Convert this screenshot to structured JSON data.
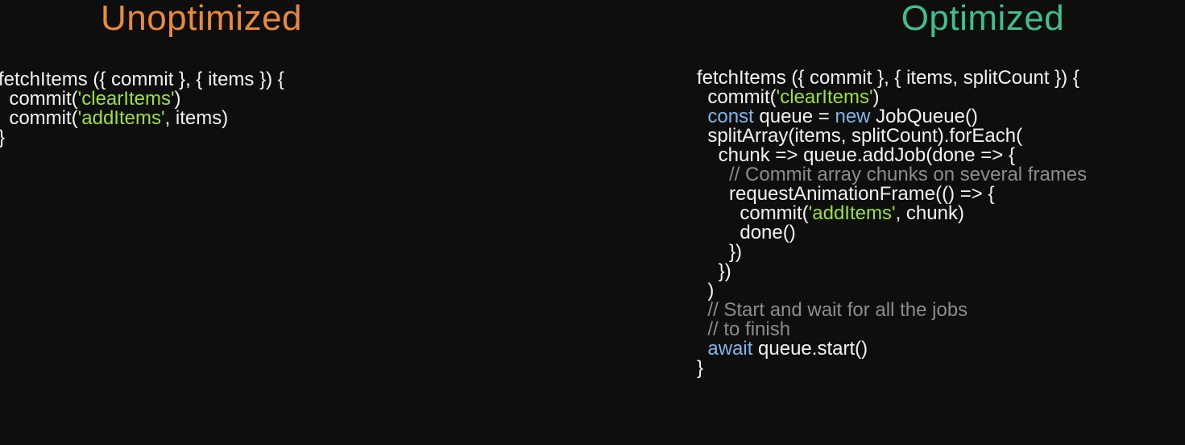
{
  "colors": {
    "unoptimized": "#e8893c",
    "optimized": "#3fbf8f",
    "string": "#9be03c",
    "keyword": "#7fb6ea",
    "comment": "#8c8c8c",
    "plain": "#f2f2f2"
  },
  "left": {
    "title": "Unoptimized",
    "lines": [
      [
        {
          "t": "fetchItems ({ commit }, { items }) {",
          "c": "plain"
        }
      ],
      [
        {
          "t": "  commit(",
          "c": "plain"
        },
        {
          "t": "'clearItems'",
          "c": "string"
        },
        {
          "t": ")",
          "c": "plain"
        }
      ],
      [
        {
          "t": "  commit(",
          "c": "plain"
        },
        {
          "t": "'addItems'",
          "c": "string"
        },
        {
          "t": ", items)",
          "c": "plain"
        }
      ],
      [
        {
          "t": "}",
          "c": "plain"
        }
      ]
    ]
  },
  "right": {
    "title": "Optimized",
    "lines": [
      [
        {
          "t": "fetchItems ({ commit }, { items, splitCount }) {",
          "c": "plain"
        }
      ],
      [
        {
          "t": "  commit(",
          "c": "plain"
        },
        {
          "t": "'clearItems'",
          "c": "string"
        },
        {
          "t": ")",
          "c": "plain"
        }
      ],
      [
        {
          "t": "  ",
          "c": "plain"
        },
        {
          "t": "const",
          "c": "keyword"
        },
        {
          "t": " queue = ",
          "c": "plain"
        },
        {
          "t": "new",
          "c": "keyword"
        },
        {
          "t": " JobQueue()",
          "c": "plain"
        }
      ],
      [
        {
          "t": "  splitArray(items, splitCount).forEach(",
          "c": "plain"
        }
      ],
      [
        {
          "t": "    chunk => queue.addJob(done => {",
          "c": "plain"
        }
      ],
      [
        {
          "t": "      // Commit array chunks on several frames",
          "c": "comment"
        }
      ],
      [
        {
          "t": "      requestAnimationFrame(() => {",
          "c": "plain"
        }
      ],
      [
        {
          "t": "        commit(",
          "c": "plain"
        },
        {
          "t": "'addItems'",
          "c": "string"
        },
        {
          "t": ", chunk)",
          "c": "plain"
        }
      ],
      [
        {
          "t": "        done()",
          "c": "plain"
        }
      ],
      [
        {
          "t": "      })",
          "c": "plain"
        }
      ],
      [
        {
          "t": "    })",
          "c": "plain"
        }
      ],
      [
        {
          "t": "  )",
          "c": "plain"
        }
      ],
      [
        {
          "t": "  // Start and wait for all the jobs",
          "c": "comment"
        }
      ],
      [
        {
          "t": "  // to finish",
          "c": "comment"
        }
      ],
      [
        {
          "t": "  ",
          "c": "plain"
        },
        {
          "t": "await",
          "c": "keyword"
        },
        {
          "t": " queue.start()",
          "c": "plain"
        }
      ],
      [
        {
          "t": "}",
          "c": "plain"
        }
      ]
    ]
  }
}
